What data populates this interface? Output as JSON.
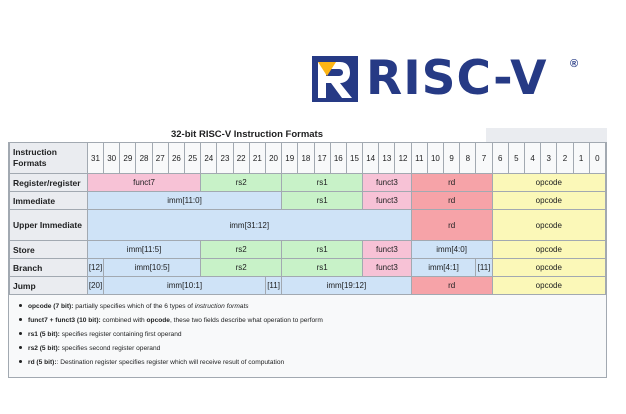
{
  "logo": {
    "text": "RISC-V",
    "reg": "®"
  },
  "table": {
    "caption": "32-bit RISC-V Instruction Formats",
    "header_label": "Instruction Formats",
    "bits": [
      "31",
      "30",
      "29",
      "28",
      "27",
      "26",
      "25",
      "24",
      "23",
      "22",
      "21",
      "20",
      "19",
      "18",
      "17",
      "16",
      "15",
      "14",
      "13",
      "12",
      "11",
      "10",
      "9",
      "8",
      "7",
      "6",
      "5",
      "4",
      "3",
      "2",
      "1",
      "0"
    ],
    "rows": [
      {
        "label": "Register/register",
        "tall": false,
        "cells": [
          {
            "text": "funct7",
            "span": 7,
            "color": "pk"
          },
          {
            "text": "rs2",
            "span": 5,
            "color": "gr"
          },
          {
            "text": "rs1",
            "span": 5,
            "color": "gr"
          },
          {
            "text": "funct3",
            "span": 3,
            "color": "pk"
          },
          {
            "text": "rd",
            "span": 5,
            "color": "rd"
          },
          {
            "text": "opcode",
            "span": 7,
            "color": "yl"
          }
        ]
      },
      {
        "label": "Immediate",
        "tall": false,
        "cells": [
          {
            "text": "imm[11:0]",
            "span": 12,
            "color": "bl"
          },
          {
            "text": "rs1",
            "span": 5,
            "color": "gr"
          },
          {
            "text": "funct3",
            "span": 3,
            "color": "pk"
          },
          {
            "text": "rd",
            "span": 5,
            "color": "rd"
          },
          {
            "text": "opcode",
            "span": 7,
            "color": "yl"
          }
        ]
      },
      {
        "label": "Upper Immediate",
        "tall": true,
        "cells": [
          {
            "text": "imm[31:12]",
            "span": 20,
            "color": "bl"
          },
          {
            "text": "rd",
            "span": 5,
            "color": "rd"
          },
          {
            "text": "opcode",
            "span": 7,
            "color": "yl"
          }
        ]
      },
      {
        "label": "Store",
        "tall": false,
        "cells": [
          {
            "text": "imm[11:5]",
            "span": 7,
            "color": "bl"
          },
          {
            "text": "rs2",
            "span": 5,
            "color": "gr"
          },
          {
            "text": "rs1",
            "span": 5,
            "color": "gr"
          },
          {
            "text": "funct3",
            "span": 3,
            "color": "pk"
          },
          {
            "text": "imm[4:0]",
            "span": 5,
            "color": "bl"
          },
          {
            "text": "opcode",
            "span": 7,
            "color": "yl"
          }
        ]
      },
      {
        "label": "Branch",
        "tall": false,
        "cells": [
          {
            "text": "[12]",
            "span": 1,
            "color": "bl"
          },
          {
            "text": "imm[10:5]",
            "span": 6,
            "color": "bl"
          },
          {
            "text": "rs2",
            "span": 5,
            "color": "gr"
          },
          {
            "text": "rs1",
            "span": 5,
            "color": "gr"
          },
          {
            "text": "funct3",
            "span": 3,
            "color": "pk"
          },
          {
            "text": "imm[4:1]",
            "span": 4,
            "color": "bl"
          },
          {
            "text": "[11]",
            "span": 1,
            "color": "bl"
          },
          {
            "text": "opcode",
            "span": 7,
            "color": "yl"
          }
        ]
      },
      {
        "label": "Jump",
        "tall": false,
        "cells": [
          {
            "text": "[20]",
            "span": 1,
            "color": "bl"
          },
          {
            "text": "imm[10:1]",
            "span": 10,
            "color": "bl"
          },
          {
            "text": "[11]",
            "span": 1,
            "color": "bl"
          },
          {
            "text": "imm[19:12]",
            "span": 8,
            "color": "bl"
          },
          {
            "text": "rd",
            "span": 5,
            "color": "rd"
          },
          {
            "text": "opcode",
            "span": 7,
            "color": "yl"
          }
        ]
      }
    ]
  },
  "notes": [
    {
      "term": "opcode (7 bit):",
      "desc": " partially specifies which of the 6 types of ",
      "em": "instruction formats",
      "tail": ""
    },
    {
      "term": "funct7 + funct3 (10 bit):",
      "desc": " combined with ",
      "em": "",
      "strong": "opcode",
      "tail": ", these two fields describe what operation to perform"
    },
    {
      "term": "rs1 (5 bit):",
      "desc": " specifies register containing first operand",
      "em": "",
      "tail": ""
    },
    {
      "term": "rs2 (5 bit):",
      "desc": " specifies second register operand",
      "em": "",
      "tail": ""
    },
    {
      "term": "rd (5 bit):",
      "desc": ": Destination register specifies register which will receive result of computation",
      "em": "",
      "tail": ""
    }
  ]
}
